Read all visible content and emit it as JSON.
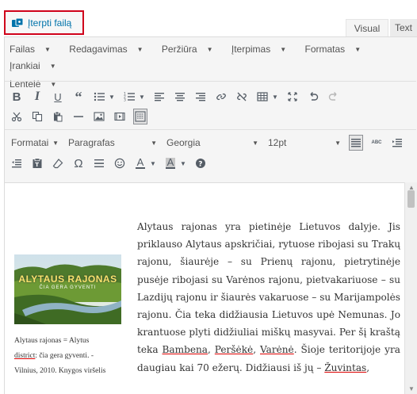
{
  "insert_button": {
    "label": "Įterpti failą",
    "icon": "media-icon"
  },
  "tabs": [
    {
      "label": "Visual",
      "active": true
    },
    {
      "label": "Text",
      "active": false
    }
  ],
  "menu": [
    "Failas",
    "Redagavimas",
    "Peržiūra",
    "Įterpimas",
    "Formatas",
    "Įrankiai",
    "Lentelė"
  ],
  "toolbar": {
    "format_select": "Formatai",
    "paragraph_select": "Paragrafas",
    "font_select": "Georgia",
    "size_select": "12pt"
  },
  "figure": {
    "cover_title": "ALYTAUS RAJONAS",
    "cover_subtitle": "ČIA GERA GYVENTI",
    "caption_1": "Alytaus rajonas = Alytus",
    "caption_2a": "district",
    "caption_2b": ": čia gera gyventi. -",
    "caption_3": "Vilnius, 2010. Knygos viršelis"
  },
  "content": {
    "p1": "Alytaus rajonas yra pietinėje Lietuvos dalyje. Jis priklauso Alytaus apskričiai, rytuose ribojasi su Trakų rajonu, šiaurėje – su Prienų rajonu, pietrytinėje pusėje ribojasi su Varėnos rajonu, pietvakariuose – su Lazdijų rajonu ir šiaurės vakaruose – su Marijampolės rajonu. Čia teka didžiausia Lietuvos upė Nemunas. Jo krantuose plyti didžiuliai miškų masyvai. Per šį kraštą teka ",
    "river_1": "Bambena",
    "sep_1": ", ",
    "river_2": "Peršėkė",
    "sep_2": ", ",
    "river_3": "Varėnė",
    "p2": ". Šioje teritorijoje yra daugiau kai 70 ežerų. Didžiausi iš jų – ",
    "lake_1": "Žuvintas",
    "p3": ","
  },
  "colors": {
    "accent": "#0073aa",
    "highlight_border": "#d0021b"
  }
}
